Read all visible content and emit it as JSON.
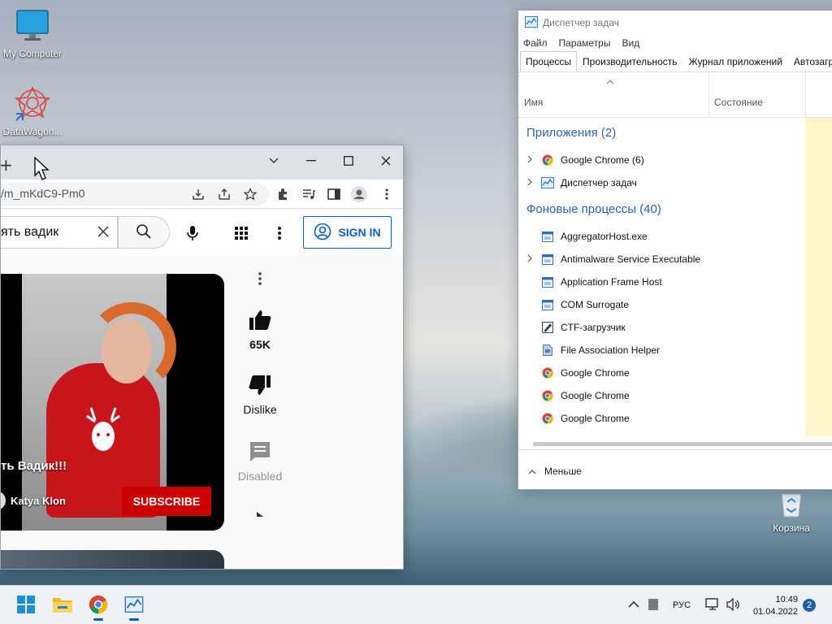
{
  "desktop": {
    "icons": [
      {
        "label": "My Computer",
        "icon": "monitor-icon"
      },
      {
        "label": "DataWagon...",
        "icon": "datawagon-icon"
      },
      {
        "label": "Корзина",
        "icon": "recycle-bin-icon"
      }
    ]
  },
  "chrome": {
    "url": "/m_mKdC9-Pm0",
    "new_tab": "+",
    "youtube": {
      "search_value": "ять вадик",
      "sign_in": "SIGN IN",
      "video_title": "ть Вадик!!!",
      "channel": "Katya Klon",
      "subscribe": "SUBSCRIBE",
      "likes": "65K",
      "dislike": "Dislike",
      "comments": "Disabled"
    }
  },
  "taskmgr": {
    "title": "Диспетчер задач",
    "menu": [
      "Файл",
      "Параметры",
      "Вид"
    ],
    "tabs": [
      "Процессы",
      "Производительность",
      "Журнал приложений",
      "Автозагру"
    ],
    "columns": {
      "name": "Имя",
      "status": "Состояние"
    },
    "apps_group": "Приложения (2)",
    "apps": [
      {
        "name": "Google Chrome (6)",
        "icon": "chrome-icon",
        "expandable": true
      },
      {
        "name": "Диспетчер задач",
        "icon": "taskmgr-icon",
        "expandable": true
      }
    ],
    "bg_group": "Фоновые процессы (40)",
    "bg": [
      {
        "name": "AggregatorHost.exe",
        "icon": "window-icon",
        "expandable": false
      },
      {
        "name": "Antimalware Service Executable",
        "icon": "window-icon",
        "expandable": true
      },
      {
        "name": "Application Frame Host",
        "icon": "window-icon",
        "expandable": false
      },
      {
        "name": "COM Surrogate",
        "icon": "window-icon",
        "expandable": false
      },
      {
        "name": "CTF-загрузчик",
        "icon": "pen-icon",
        "expandable": false
      },
      {
        "name": "File Association Helper",
        "icon": "file-icon",
        "expandable": false
      },
      {
        "name": "Google Chrome",
        "icon": "chrome-icon",
        "expandable": false
      },
      {
        "name": "Google Chrome",
        "icon": "chrome-icon",
        "expandable": false
      },
      {
        "name": "Google Chrome",
        "icon": "chrome-icon",
        "expandable": false
      }
    ],
    "less": "Меньше"
  },
  "taskbar": {
    "lang": "РУС",
    "time": "10:49",
    "date": "01.04.2022",
    "notifications": "2"
  },
  "colors": {
    "accent": "#005fb8",
    "yt_red": "#cc0000",
    "yt_blue": "#065fd4",
    "tm_group": "#2b63a7"
  }
}
